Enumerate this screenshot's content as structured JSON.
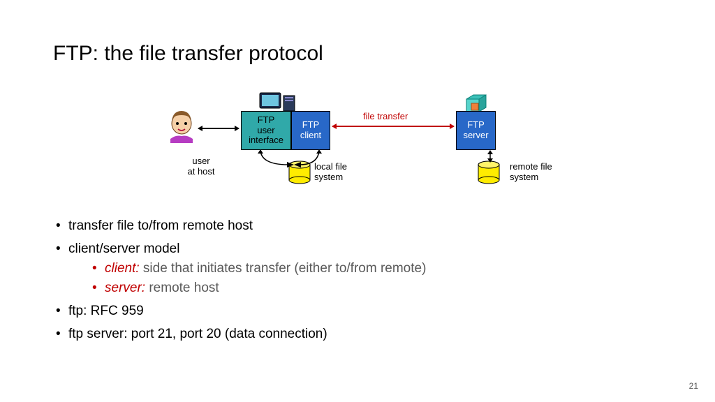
{
  "title": "FTP: the file transfer protocol",
  "diagram": {
    "user_interface_box": "FTP\nuser\ninterface",
    "client_box": "FTP\nclient",
    "server_box": "FTP\nserver",
    "user_label": "user\nat host",
    "local_fs_label": "local file\nsystem",
    "remote_fs_label": "remote file\nsystem",
    "transfer_label": "file transfer"
  },
  "bullets": {
    "b1": "transfer file to/from remote host",
    "b2": "client/server model",
    "b2a_key": "client:",
    "b2a_rest": " side that initiates transfer (either to/from remote)",
    "b2b_key": "server:",
    "b2b_rest": " remote host",
    "b3": "ftp: RFC 959",
    "b4": "ftp server: port 21, port 20 (data connection)"
  },
  "page_number": "21"
}
